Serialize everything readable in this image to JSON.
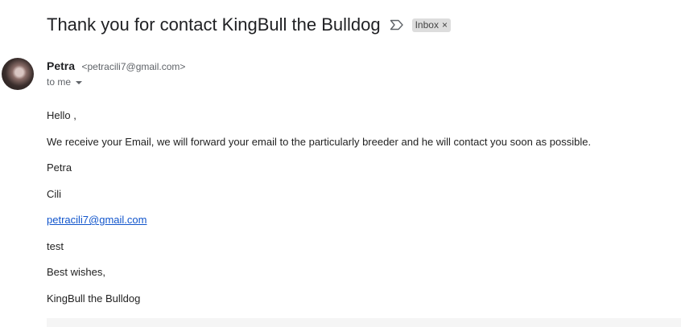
{
  "email": {
    "subject": "Thank you for contact KingBull the Bulldog",
    "label": "Inbox",
    "label_close": "×",
    "sender_name": "Petra",
    "sender_email": "<petracili7@gmail.com>",
    "to_line": "to me",
    "body": {
      "greeting": "Hello ,",
      "message": "We receive your Email, we will forward your email to the particularly breeder and he will contact you soon as possible.",
      "line_petra": "Petra",
      "line_cili": "Cili",
      "link_email": "petracili7@gmail.com",
      "line_test": "test",
      "sign_off": "Best wishes,",
      "signature": "KingBull the Bulldog"
    }
  },
  "icons": {
    "important": "important-marker-icon",
    "avatar": "sender-avatar",
    "caret": "chevron-down-icon"
  },
  "colors": {
    "link": "#1155cc",
    "chip_bg": "#dddddd",
    "muted_text": "#5f6368"
  }
}
